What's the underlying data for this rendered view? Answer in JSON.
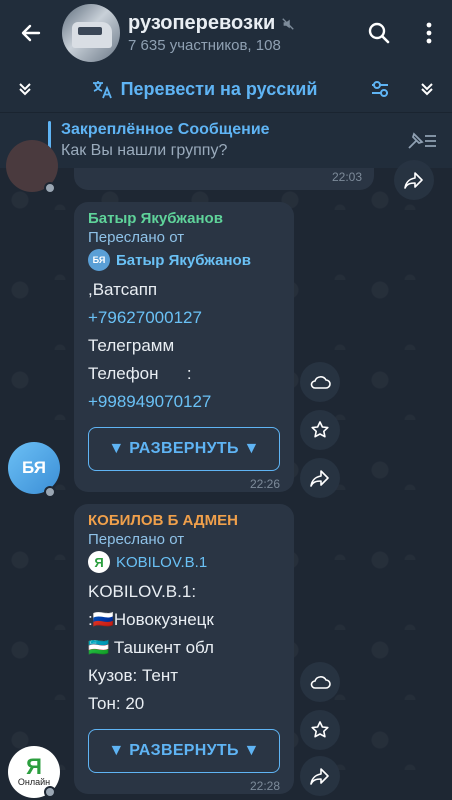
{
  "header": {
    "title": "рузоперевозки",
    "subtitle": "7 635 участников, 108"
  },
  "translate_bar": {
    "label": "Перевести на русский"
  },
  "pinned": {
    "title": "Закреплённое Сообщение",
    "text": "Как Вы нашли группу?"
  },
  "top_message": {
    "time": "22:03"
  },
  "messages": [
    {
      "sender": "Батыр Якубжанов",
      "sender_color": "#5fd39a",
      "forward_label": "Переслано от",
      "forward_from": "Батыр Якубжанов",
      "forward_avatar_initials": "БЯ",
      "lines": [
        ",Ватсапп",
        "+79627000127",
        "Телеграмм",
        "Телефон      :",
        "+998949070127"
      ],
      "expand_label": "▼ РАЗВЕРНУТЬ ▼",
      "time": "22:26",
      "avatar_initials": "БЯ"
    },
    {
      "sender": "КОБИЛОВ Б АДМЕН",
      "sender_color": "#f0a04b",
      "forward_label": "Переслано от",
      "forward_from": "KOBILOV.B.1",
      "lines": [
        "KOBILOV.B.1:",
        ":🇷🇺Новокузнецк",
        "🇺🇿 Ташкент обл",
        "Кузов: Тент",
        "Тон: 20"
      ],
      "expand_label": "▼ РАЗВЕРНУТЬ ▼",
      "time": "22:28",
      "avatar_text": "Онлайн"
    }
  ],
  "colors": {
    "accent": "#5fb4f4",
    "bubble": "#2a3544",
    "header": "#212d3b"
  }
}
